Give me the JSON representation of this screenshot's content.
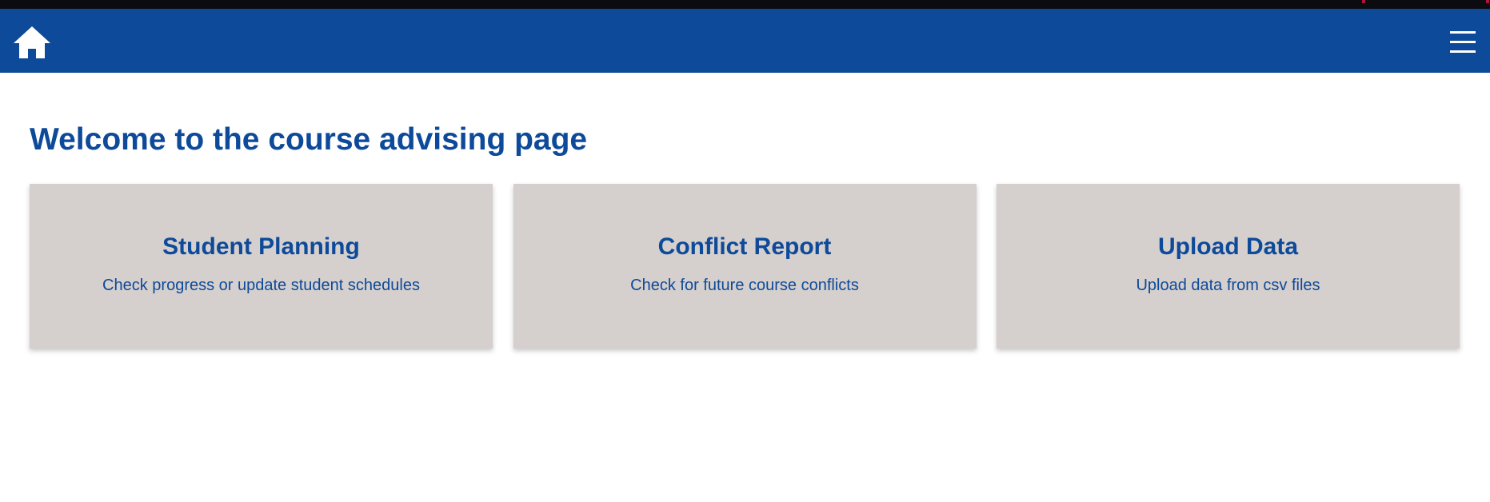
{
  "colors": {
    "brand": "#0d4a99",
    "card_bg": "#d5cfcd",
    "top_strip": "#0c0c10",
    "background": "#ffffff"
  },
  "navbar": {
    "home_icon": "home-icon",
    "menu_icon": "hamburger-menu-icon"
  },
  "main": {
    "title": "Welcome to the course advising page",
    "cards": [
      {
        "title": "Student Planning",
        "description": "Check progress or update student schedules"
      },
      {
        "title": "Conflict Report",
        "description": "Check for future course conflicts"
      },
      {
        "title": "Upload Data",
        "description": "Upload data from csv files"
      }
    ]
  }
}
